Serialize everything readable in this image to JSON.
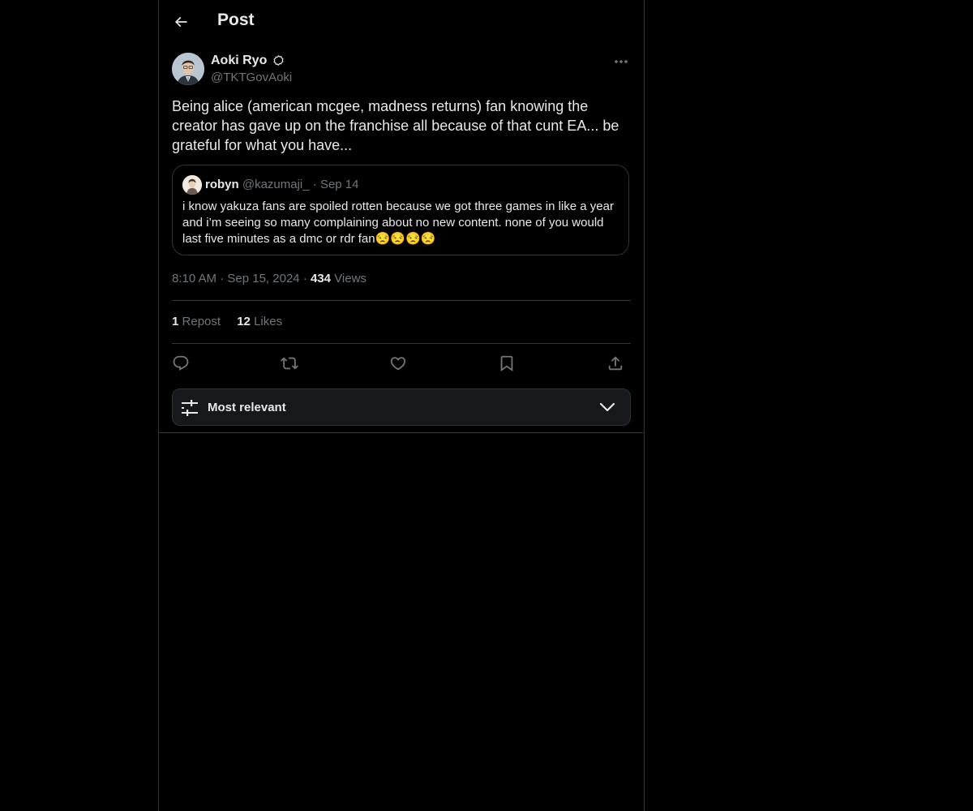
{
  "header": {
    "title": "Post"
  },
  "post": {
    "author_name": "Aoki Ryo",
    "author_handle": "@TKTGovAoki",
    "text": "Being alice (american mcgee, madness returns) fan knowing the creator has gave up on the franchise all because of that cunt EA... be grateful for what you have...",
    "quote": {
      "name": "robyn",
      "handle": "@kazumaji_",
      "separator": "·",
      "date": "Sep 14",
      "text": "i know yakuza fans are spoiled rotten because we got three games in like a year and i’m seeing so many complaining about no new content. none of you would last five minutes as a dmc or rdr fan😒😒😒😒"
    },
    "time": "8:10 AM",
    "date": "Sep 15, 2024",
    "separator": "·",
    "views_count": "434",
    "views_label": "Views",
    "reposts_count": "1",
    "reposts_label": "Repost",
    "likes_count": "12",
    "likes_label": "Likes"
  },
  "sort": {
    "label": "Most relevant"
  },
  "colors": {
    "background": "#000000",
    "text": "#e7e9ea",
    "muted": "#71767b",
    "border": "#2f3336"
  },
  "icons": [
    "back-arrow-icon",
    "verified-badge-icon",
    "more-icon",
    "reply-icon",
    "repost-icon",
    "like-icon",
    "bookmark-icon",
    "share-icon",
    "sliders-icon",
    "chevron-down-icon"
  ]
}
